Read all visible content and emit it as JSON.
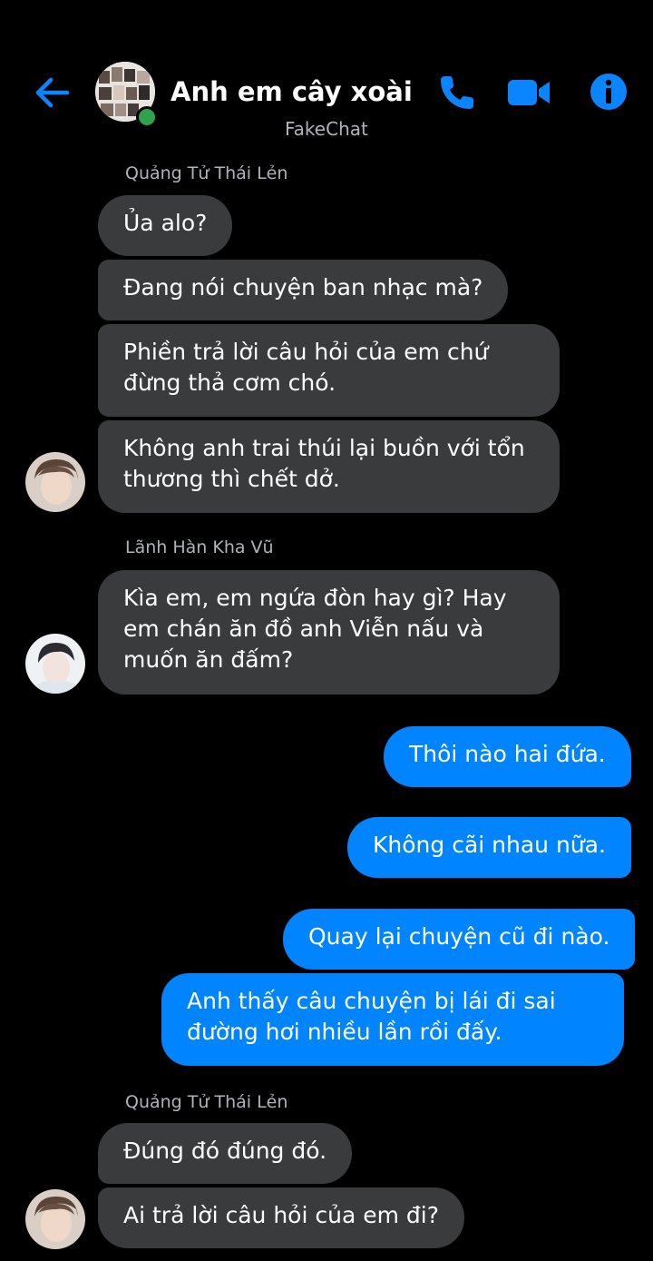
{
  "header": {
    "title": "Anh em cây xoài",
    "subtitle": "FakeChat",
    "accent_color": "#0084ff",
    "icons": [
      "back-arrow-icon",
      "group-avatar",
      "phone-icon",
      "video-camera-icon",
      "info-icon"
    ]
  },
  "messages": {
    "m1_sender": "Quảng Tử Thái Lẻn",
    "m1": "Ủa alo?",
    "m2": "Đang nói chuyện ban nhạc mà?",
    "m3_line1": "Phiền trả lời câu hỏi của em chứ",
    "m3_line2": "đừng thả cơm chó.",
    "m4_line1": "Không anh trai thúi lại buồn với tổn",
    "m4_line2": "thương thì chết dở.",
    "m5_sender": "Lãnh Hàn Kha Vũ",
    "m5_line1": "Kìa em, em ngứa đòn hay gì? Hay",
    "m5_line2": "em chán ăn đồ anh Viễn nấu và",
    "m5_line3": "muốn ăn đấm?",
    "o1": "Thôi nào hai đứa.",
    "o2": "Không cãi nhau nữa.",
    "o3": "Quay lại chuyện cũ đi nào.",
    "o4_line1": "Anh thấy câu chuyện bị lái đi sai",
    "o4_line2": "đường hơi nhiều lần rồi đấy.",
    "m6_sender": "Quảng Tử Thái Lẻn",
    "m6": "Đúng đó đúng đó.",
    "m7": "Ai trả lời câu hỏi của em đi?"
  },
  "colors": {
    "background": "#000000",
    "incoming_bubble": "#3a3b3c",
    "outgoing_bubble": "#0084ff",
    "online_status": "#31a24c"
  }
}
